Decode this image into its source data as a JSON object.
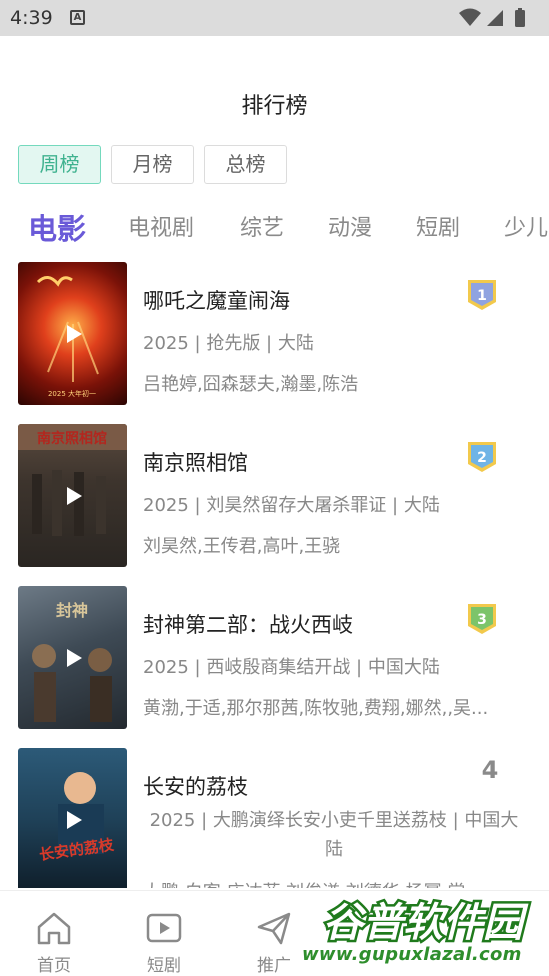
{
  "status_bar": {
    "time": "4:39",
    "notification_letter": "A"
  },
  "header": {
    "title": "排行榜"
  },
  "period_tabs": [
    {
      "label": "周榜",
      "active": true
    },
    {
      "label": "月榜",
      "active": false
    },
    {
      "label": "总榜",
      "active": false
    }
  ],
  "category_tabs": [
    {
      "label": "电影",
      "active": true
    },
    {
      "label": "电视剧",
      "active": false
    },
    {
      "label": "综艺",
      "active": false
    },
    {
      "label": "动漫",
      "active": false
    },
    {
      "label": "短剧",
      "active": false
    },
    {
      "label": "少儿",
      "active": false
    }
  ],
  "items": [
    {
      "rank": "1",
      "title": "哪吒之魔童闹海",
      "meta": "2025 | 抢先版 | 大陆",
      "cast": "吕艳婷,囧森瑟夫,瀚墨,陈浩",
      "poster_caption": "2025 大年初一"
    },
    {
      "rank": "2",
      "title": "南京照相馆",
      "meta": "2025 | 刘昊然留存大屠杀罪证 | 大陆",
      "cast": "刘昊然,王传君,高叶,王骁",
      "poster_caption": "南京照相馆"
    },
    {
      "rank": "3",
      "title": "封神第二部：战火西岐",
      "meta": "2025 | 西岐殷商集结开战 | 中国大陆",
      "cast": "黄渤,于适,那尔那茜,陈牧驰,费翔,娜然,,吴...",
      "poster_caption": "封神"
    },
    {
      "rank": "4",
      "title": "长安的荔枝",
      "meta": "2025 | 大鹏演绎长安小吏千里送荔枝 | 中国大陆",
      "cast": "大鹏,白客,庄达菲,刘俊谦,刘德华,杨幂,常...",
      "poster_caption": "长安的荔枝"
    }
  ],
  "bottom_nav": [
    {
      "label": "首页",
      "icon": "home-icon"
    },
    {
      "label": "短剧",
      "icon": "video-play-icon"
    },
    {
      "label": "推广",
      "icon": "paper-plane-icon"
    }
  ],
  "watermark": {
    "title": "谷普软件园",
    "url": "www.gupuxlazal.com"
  },
  "colors": {
    "accent": "#6a5ad8",
    "tab_active_bg": "#e3f7f1",
    "tab_active_text": "#3fb28f"
  }
}
